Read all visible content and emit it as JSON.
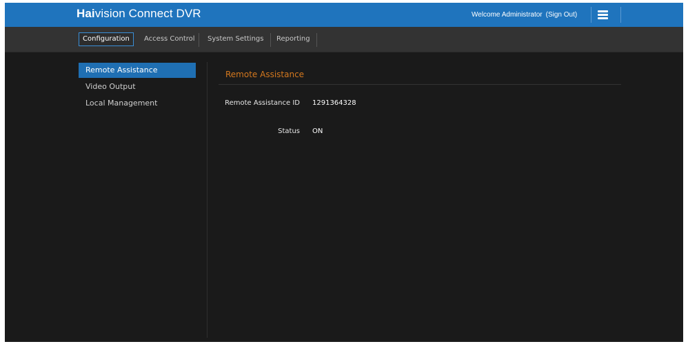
{
  "header": {
    "logo_bold": "Hai",
    "logo_rest": "vision Connect DVR",
    "welcome": "Welcome Administrator",
    "sign_out": "(Sign Out)",
    "menu_icon": "hamburger-menu-icon"
  },
  "nav": {
    "tabs": [
      {
        "label": "Configuration",
        "active": true
      },
      {
        "label": "Access Control",
        "active": false
      },
      {
        "label": "System Settings",
        "active": false
      },
      {
        "label": "Reporting",
        "active": false
      }
    ]
  },
  "sidebar": {
    "items": [
      {
        "label": "Remote Assistance",
        "active": true
      },
      {
        "label": "Video Output",
        "active": false
      },
      {
        "label": "Local Management",
        "active": false
      }
    ]
  },
  "main": {
    "title": "Remote Assistance",
    "fields": [
      {
        "label": "Remote Assistance ID",
        "value": "1291364328"
      },
      {
        "label": "Status",
        "value": "ON"
      }
    ]
  },
  "colors": {
    "header_blue": "#1f74bd",
    "accent_orange": "#d4781e",
    "active_item": "#1f6fb3",
    "background": "#1a1a1a"
  }
}
